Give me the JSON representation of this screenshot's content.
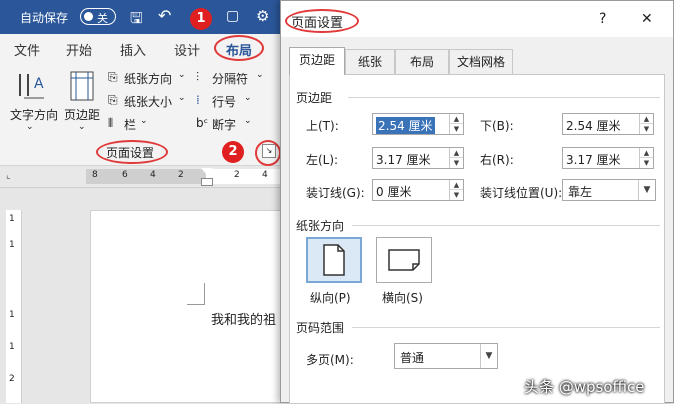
{
  "titlebar": {
    "autosave_label": "自动保存",
    "toggle_label": "关"
  },
  "tabs": [
    {
      "label": "文件"
    },
    {
      "label": "开始"
    },
    {
      "label": "插入"
    },
    {
      "label": "设计"
    },
    {
      "label": "布局"
    }
  ],
  "annotations": {
    "badge1": "1",
    "badge2": "2"
  },
  "ribbon": {
    "text_direction": "文字方向",
    "margins": "页边距",
    "orientation": "纸张方向",
    "size": "纸张大小",
    "columns": "栏",
    "breaks": "分隔符",
    "line_numbers": "行号",
    "hyphenation": "断字",
    "group_label": "页面设置"
  },
  "ruler": {
    "ticks": [
      "8",
      "6",
      "4",
      "2",
      "2",
      "4"
    ]
  },
  "vruler": {
    "ticks": [
      "1",
      "1",
      "1",
      "1",
      "2"
    ]
  },
  "document": {
    "text": "我和我的祖"
  },
  "dialog": {
    "title": "页面设置",
    "help": "?",
    "close": "✕",
    "tabs": [
      "页边距",
      "纸张",
      "布局",
      "文档网格"
    ],
    "margins_section": "页边距",
    "top_label": "上(T):",
    "top_value": "2.54 厘米",
    "bottom_label": "下(B):",
    "bottom_value": "2.54 厘米",
    "left_label": "左(L):",
    "left_value": "3.17 厘米",
    "right_label": "右(R):",
    "right_value": "3.17 厘米",
    "gutter_label": "装订线(G):",
    "gutter_value": "0 厘米",
    "gutter_pos_label": "装订线位置(U):",
    "gutter_pos_value": "靠左",
    "orientation_section": "纸张方向",
    "portrait": "纵向(P)",
    "landscape": "横向(S)",
    "pages_section": "页码范围",
    "multiple_pages_label": "多页(M):",
    "multiple_pages_value": "普通"
  },
  "watermark": "头条 @wpsoffice",
  "colors": {
    "word_blue": "#2b579a",
    "annotation_red": "#e02020",
    "selection_blue": "#3b73b9"
  }
}
